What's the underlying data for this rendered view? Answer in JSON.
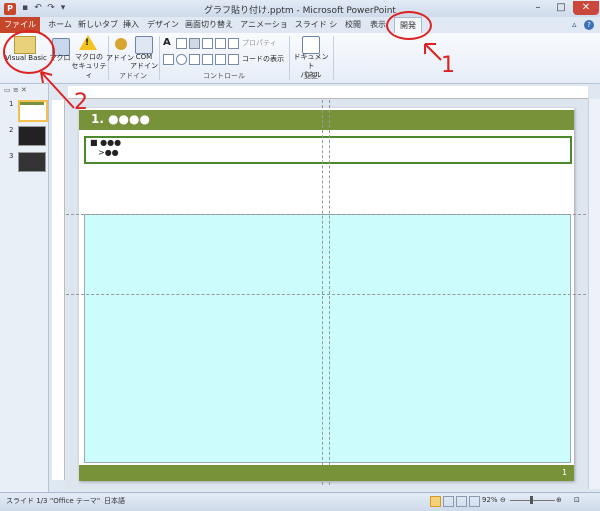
{
  "window": {
    "title": "グラフ貼り付け.pptm - Microsoft PowerPoint",
    "app_icon": "P",
    "qat_icons": [
      "save-icon",
      "undo-icon",
      "redo-icon",
      "customize-icon"
    ],
    "buttons": [
      "minimize",
      "maximize",
      "close"
    ]
  },
  "tabs": [
    {
      "id": "file",
      "label": "ファイル"
    },
    {
      "id": "home",
      "label": "ホーム"
    },
    {
      "id": "newtab",
      "label": "新しいタブ"
    },
    {
      "id": "insert",
      "label": "挿入"
    },
    {
      "id": "design",
      "label": "デザイン"
    },
    {
      "id": "transitions",
      "label": "画面切り替え"
    },
    {
      "id": "animations",
      "label": "アニメーション"
    },
    {
      "id": "slideshow",
      "label": "スライド ショー"
    },
    {
      "id": "review",
      "label": "校閲"
    },
    {
      "id": "view",
      "label": "表示"
    },
    {
      "id": "developer",
      "label": "開発"
    }
  ],
  "ribbon": {
    "code": {
      "visual_basic": "Visual Basic",
      "macro": "マクロ",
      "macro_security_1": "マクロの",
      "macro_security_2": "セキュリティ"
    },
    "addins": {
      "addin": "アドイン",
      "com_addin_1": "COM",
      "com_addin_2": "アドイン",
      "group_label": "アドイン"
    },
    "controls": {
      "properties": "プロパティ",
      "view_code": "コードの表示",
      "group_label": "コントロール"
    },
    "modify": {
      "document_panel_1": "ドキュメント",
      "document_panel_2": "パネル",
      "group_label": "変更"
    }
  },
  "slides_pane": {
    "slides": [
      {
        "number": "1"
      },
      {
        "number": "2"
      },
      {
        "number": "3"
      }
    ]
  },
  "slide": {
    "title": "1. ●●●●",
    "bullet1": "■ ●●●",
    "bullet2": ">●●",
    "slide_number": "1",
    "theme_color": "#78923a",
    "content_fill": "#ccfcfc"
  },
  "status": {
    "slide_info": "スライド 1/3",
    "theme": "\"Office テーマ\"",
    "language": "日本語",
    "zoom": "92%"
  },
  "annotations": {
    "arrow_label_1": "1",
    "arrow_label_2": "2",
    "color": "#dd2222"
  }
}
